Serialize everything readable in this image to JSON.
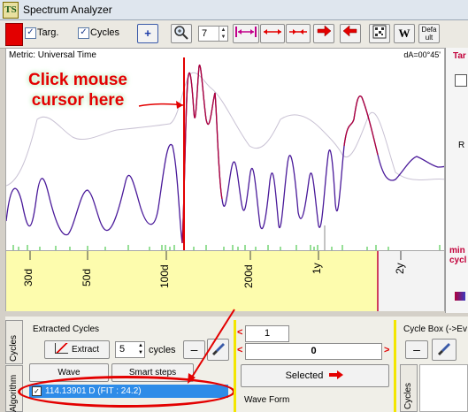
{
  "window": {
    "title": "Spectrum Analyzer",
    "logo_text": "TS"
  },
  "toolbar": {
    "targ_label": "Targ.",
    "cycles_label": "Cycles",
    "zoom_value": "7",
    "default_label": "Defa ult",
    "w_label": "W",
    "plus_label": "+"
  },
  "chart": {
    "metric_label": "Metric: Universal Time",
    "dA_label": "dA=00°45'",
    "annotation": "Click mouse cursor here",
    "x_ticks": [
      "30d",
      "50d",
      "100d",
      "200d",
      "1y",
      "2y"
    ],
    "right_labels": {
      "tar": "Tar",
      "r": "R",
      "min": "min",
      "cyc": "cycl"
    }
  },
  "bottom": {
    "tab_cycles": "Cycles",
    "tab_algorithm": "Algorithm",
    "extracted_title": "Extracted Cycles",
    "extract_button": "Extract",
    "cycles_count": "5",
    "cycles_unit": "cycles",
    "minus_label": "–",
    "wave_button": "Wave",
    "smart_steps_button": "Smart steps",
    "selected_item_text": "114.13901 D  (FIT : 24.2)",
    "counter_value": "1",
    "value_box": "0",
    "selected_button": "Selected",
    "wave_form_title": "Wave Form",
    "cycle_box_title": "Cycle Box (->Ev",
    "cycles_tab2": "Cycles"
  },
  "colors": {
    "accent_red": "#e30000",
    "selection_blue": "#2e8ce8",
    "axis_yellow": "#fdfcad"
  }
}
